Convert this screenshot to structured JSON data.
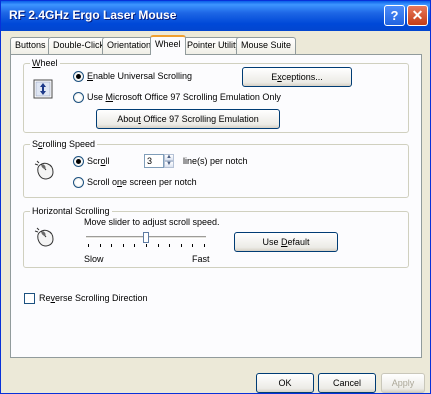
{
  "window": {
    "title": "RF 2.4GHz Ergo Laser Mouse",
    "help_label": "?",
    "close_label": "✕"
  },
  "tabs": [
    {
      "label": "Buttons",
      "active": false
    },
    {
      "label": "Double-Click",
      "active": false
    },
    {
      "label": "Orientation",
      "active": false
    },
    {
      "label": "Wheel",
      "active": true
    },
    {
      "label": "Pointer Utility",
      "active": false
    },
    {
      "label": "Mouse Suite",
      "active": false
    }
  ],
  "wheel_group": {
    "title_ul": "W",
    "title_rest": "heel",
    "option_universal_ul": "E",
    "option_universal_rest": "nable Universal Scrolling",
    "option_universal_selected": true,
    "option_office_pre": "Use ",
    "option_office_ul": "M",
    "option_office_rest": "icrosoft Office 97 Scrolling Emulation Only",
    "option_office_selected": false,
    "exceptions_pre": "E",
    "exceptions_ul": "x",
    "exceptions_rest": "ceptions...",
    "about_pre": "Abou",
    "about_ul": "t",
    "about_rest": " Office 97 Scrolling Emulation",
    "icon": "scroll-arrows-icon"
  },
  "speed_group": {
    "title_pre": "S",
    "title_ul": "c",
    "title_rest": "rolling Speed",
    "option_scroll_pre": "Scr",
    "option_scroll_ul": "o",
    "option_scroll_rest": "ll",
    "option_scroll_selected": true,
    "lines_value": "3",
    "lines_suffix": "line(s) per notch",
    "option_screen_pre": "Scroll o",
    "option_screen_ul": "n",
    "option_screen_rest": "e screen per notch",
    "option_screen_selected": false,
    "icon": "mouse-wheel-icon"
  },
  "horizontal_group": {
    "title": "Horizontal Scrolling",
    "instruction": "Move slider to adjust scroll speed.",
    "slow_label": "Slow",
    "fast_label": "Fast",
    "slider_value_fraction": 0.5,
    "default_pre": "Use ",
    "default_ul": "D",
    "default_rest": "efault",
    "icon": "mouse-wheel-icon"
  },
  "reverse": {
    "pre": "Re",
    "ul": "v",
    "rest": "erse Scrolling Direction",
    "checked": false
  },
  "footer": {
    "ok": "OK",
    "cancel": "Cancel",
    "apply": "Apply"
  },
  "colors": {
    "title_bar": "#0a5fe8",
    "tab_highlight": "#f0a030",
    "radio_dot": "#21a121"
  }
}
